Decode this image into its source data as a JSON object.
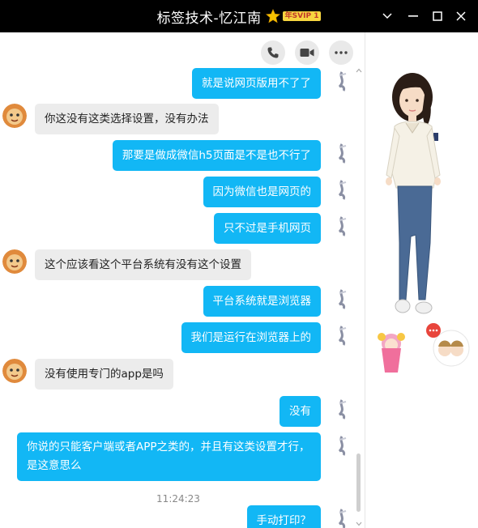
{
  "window": {
    "title": "标签技术-忆江南",
    "vip_badge": "年SVIP 1"
  },
  "colors": {
    "titlebar": "#000000",
    "my_bubble": "#12b7f5",
    "their_bubble": "#ececec"
  },
  "toolbar": {
    "icons": [
      "phone-icon",
      "video-icon",
      "more-icon"
    ]
  },
  "messages": [
    {
      "from": "me",
      "text": "就是说网页版用不了了"
    },
    {
      "from": "them",
      "text": "你这没有这类选择设置，没有办法"
    },
    {
      "from": "me",
      "text": "那要是做成微信h5页面是不是也不行了"
    },
    {
      "from": "me",
      "text": "因为微信也是网页的"
    },
    {
      "from": "me",
      "text": "只不过是手机网页"
    },
    {
      "from": "them",
      "text": "这个应该看这个平台系统有没有这个设置"
    },
    {
      "from": "me",
      "text": "平台系统就是浏览器"
    },
    {
      "from": "me",
      "text": "我们是运行在浏览器上的"
    },
    {
      "from": "them",
      "text": "没有使用专门的app是吗"
    },
    {
      "from": "me",
      "text": "没有"
    },
    {
      "from": "me",
      "text": "你说的只能客户端或者APP之类的，并且有这类设置才行，是这意思么"
    },
    {
      "from": "me",
      "text": "手动打印？"
    }
  ],
  "timestamp": "11:24:23"
}
